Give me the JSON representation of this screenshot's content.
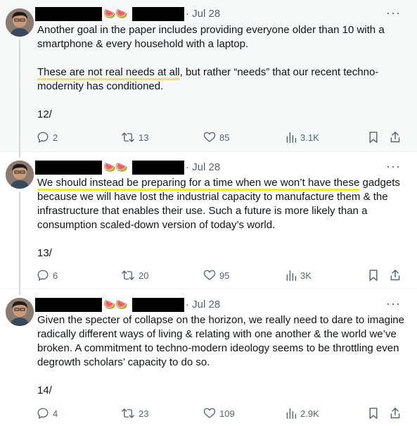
{
  "tweets": [
    {
      "date": "· Jul 28",
      "emoji": "🍉🍉",
      "paragraphs": [
        "Another goal in the paper includes providing everyone older than 10 with a smartphone & every household with a laptop.",
        "",
        "12/"
      ],
      "highlight_text": "These are not real needs at all",
      "rest_text": ", but rather “needs” that our recent techno-modernity has conditioned.",
      "replies": "2",
      "retweets": "13",
      "likes": "85",
      "views": "3.1K"
    },
    {
      "date": "· Jul 28",
      "emoji": "🍉🍉",
      "highlight_text": "We should instead be preparing for a time when we won’t have these",
      "rest_text": " gadgets because we will have lost the industrial capacity to manufacture them & the infrastructure that enables their use. Such a future is more likely than a consumption scaled-down version of today’s world.",
      "number": "13/",
      "replies": "6",
      "retweets": "20",
      "likes": "95",
      "views": "3K"
    },
    {
      "date": "· Jul 28",
      "emoji": "🍉🍉",
      "text": "Given the specter of collapse on the horizon, we really need to dare to imagine radically different ways of living & relating with one another & the world we’ve broken. A commitment to techno-modern ideology seems to be throttling even degrowth scholars’ capacity to do so.",
      "number": "14/",
      "replies": "4",
      "retweets": "23",
      "likes": "109",
      "views": "2.9K"
    }
  ],
  "more_label": "···",
  "colors": {
    "icon": "#536471",
    "highlight": "#f2ea3a",
    "text": "#0f1419"
  }
}
